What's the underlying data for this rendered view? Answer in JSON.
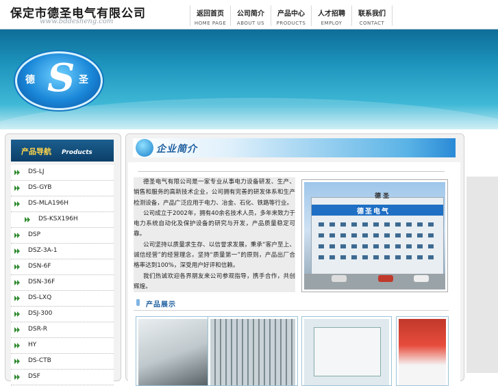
{
  "header": {
    "company_name": "保定市德圣电气有限公司",
    "site_url": "www.bddesheng.com",
    "nav": [
      {
        "cn": "返回首页",
        "en": "HOME PAGE"
      },
      {
        "cn": "公司简介",
        "en": "ABOUT US"
      },
      {
        "cn": "产品中心",
        "en": "PRODUCTS"
      },
      {
        "cn": "人才招聘",
        "en": "EMPLOY"
      },
      {
        "cn": "联系我们",
        "en": "CONTACT"
      }
    ]
  },
  "banner": {
    "emblem_letter": "S",
    "emblem_left": "德",
    "emblem_right": "圣"
  },
  "sidebar": {
    "title_cn": "产品导航",
    "title_en": "Products",
    "items": [
      {
        "label": "DS-LJ"
      },
      {
        "label": "DS-GYB"
      },
      {
        "label": "DS-MLA196H"
      },
      {
        "label": "DS-KSX196H"
      },
      {
        "label": "DSP"
      },
      {
        "label": "DSZ-3A-1"
      },
      {
        "label": "DSN-6F"
      },
      {
        "label": "DSN-36F"
      },
      {
        "label": "DS-LXQ"
      },
      {
        "label": "DSJ-300"
      },
      {
        "label": "DSR-R"
      },
      {
        "label": "HY"
      },
      {
        "label": "DS-CTB"
      },
      {
        "label": "DSF"
      }
    ]
  },
  "main": {
    "section_title": "企业简介",
    "intro": [
      "德圣电气有限公司是一家专业从事电力设备研发、生产、销售和服务的高新技术企业，公司拥有完善的研发体系和生产检测设备，产品广泛应用于电力、冶金、石化、铁路等行业。",
      "公司成立于2002年，拥有40余名技术人员，多年来致力于电力系统自动化及保护设备的研究与开发，产品质量稳定可靠。",
      "公司坚持以质量求生存、以信誉求发展，秉承“客户至上、诚信经营”的经营理念，坚持“质量第一”的原则，产品出厂合格率达到100%，深受用户好评和信赖。",
      "我们热诚欢迎各界朋友来公司参观指导，携手合作，共创辉煌。"
    ],
    "building_sign": "德圣电气",
    "building_top": "德 圣",
    "products_title": "产品展示"
  },
  "colors": {
    "nav_text": "#222222",
    "sidebar_head": "#1b5f8f",
    "accent_blue": "#1d5e9e",
    "arrow_green": "#2f8a2f"
  }
}
